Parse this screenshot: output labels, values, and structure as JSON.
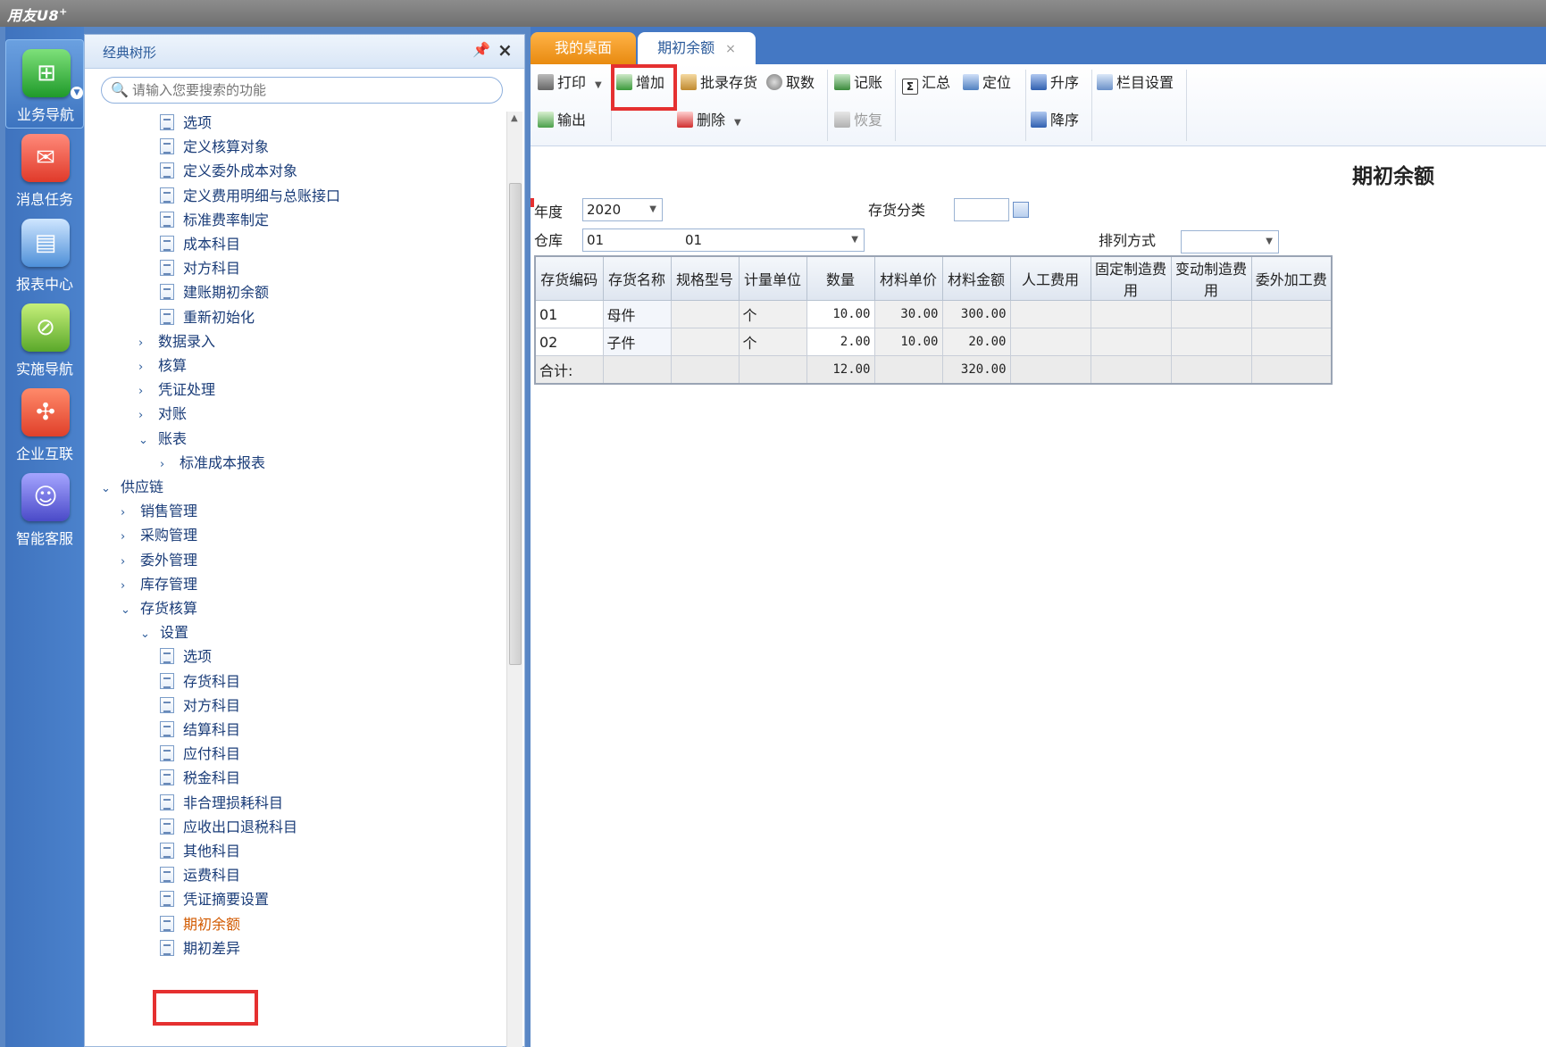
{
  "app": {
    "logo": "用友U8",
    "logo_sup": "+"
  },
  "leftnav": [
    {
      "label": "业务导航",
      "icon": "business-nav-icon",
      "glyph": "⊞"
    },
    {
      "label": "消息任务",
      "icon": "message-task-icon",
      "glyph": "✉"
    },
    {
      "label": "报表中心",
      "icon": "report-center-icon",
      "glyph": "▤"
    },
    {
      "label": "实施导航",
      "icon": "compass-icon",
      "glyph": "⊘"
    },
    {
      "label": "企业互联",
      "icon": "enterprise-link-icon",
      "glyph": "✣"
    },
    {
      "label": "智能客服",
      "icon": "customer-service-icon",
      "glyph": "☺"
    }
  ],
  "tree": {
    "title": "经典树形",
    "search_placeholder": "请输入您要搜索的功能",
    "items": [
      {
        "label": "选项",
        "type": "leaf"
      },
      {
        "label": "定义核算对象",
        "type": "leaf"
      },
      {
        "label": "定义委外成本对象",
        "type": "leaf"
      },
      {
        "label": "定义费用明细与总账接口",
        "type": "leaf"
      },
      {
        "label": "标准费率制定",
        "type": "leaf"
      },
      {
        "label": "成本科目",
        "type": "leaf"
      },
      {
        "label": "对方科目",
        "type": "leaf"
      },
      {
        "label": "建账期初余额",
        "type": "leaf"
      },
      {
        "label": "重新初始化",
        "type": "leaf"
      },
      {
        "label": "数据录入",
        "type": "collapsed"
      },
      {
        "label": "核算",
        "type": "collapsed"
      },
      {
        "label": "凭证处理",
        "type": "collapsed"
      },
      {
        "label": "对账",
        "type": "collapsed"
      },
      {
        "label": "账表",
        "type": "expanded"
      },
      {
        "label": "标准成本报表",
        "type": "collapsed"
      },
      {
        "label": "供应链",
        "type": "expanded"
      },
      {
        "label": "销售管理",
        "type": "collapsed"
      },
      {
        "label": "采购管理",
        "type": "collapsed"
      },
      {
        "label": "委外管理",
        "type": "collapsed"
      },
      {
        "label": "库存管理",
        "type": "collapsed"
      },
      {
        "label": "存货核算",
        "type": "expanded"
      },
      {
        "label": "设置",
        "type": "expanded"
      },
      {
        "label": "选项",
        "type": "leaf"
      },
      {
        "label": "存货科目",
        "type": "leaf"
      },
      {
        "label": "对方科目",
        "type": "leaf"
      },
      {
        "label": "结算科目",
        "type": "leaf"
      },
      {
        "label": "应付科目",
        "type": "leaf"
      },
      {
        "label": "税金科目",
        "type": "leaf"
      },
      {
        "label": "非合理损耗科目",
        "type": "leaf"
      },
      {
        "label": "应收出口退税科目",
        "type": "leaf"
      },
      {
        "label": "其他科目",
        "type": "leaf"
      },
      {
        "label": "运费科目",
        "type": "leaf"
      },
      {
        "label": "凭证摘要设置",
        "type": "leaf"
      },
      {
        "label": "期初余额",
        "type": "leaf",
        "selected": true
      },
      {
        "label": "期初差异",
        "type": "leaf"
      }
    ]
  },
  "tabs": {
    "desktop": "我的桌面",
    "current": "期初余额",
    "close": "×"
  },
  "toolbar": {
    "print": "打印",
    "add": "增加",
    "batch": "批录存货",
    "fetch": "取数",
    "post": "记账",
    "summary": "汇总",
    "locate": "定位",
    "asc": "升序",
    "columns": "栏目设置",
    "export": "输出",
    "delete": "删除",
    "restore": "恢复",
    "desc": "降序",
    "sum_glyph": "Σ"
  },
  "form": {
    "title": "期初余额",
    "year_label": "年度",
    "year_value": "2020",
    "category_label": "存货分类",
    "category_value": "",
    "warehouse_label": "仓库",
    "warehouse_code": "01",
    "warehouse_name": "01",
    "sort_label": "排列方式",
    "sort_value": ""
  },
  "grid": {
    "headers": [
      "存货编码",
      "存货名称",
      "规格型号",
      "计量单位",
      "数量",
      "材料单价",
      "材料金额",
      "人工费用",
      "固定制造费用",
      "变动制造费用",
      "委外加工费"
    ],
    "rows": [
      [
        "01",
        "母件",
        "",
        "个",
        "10.00",
        "30.00",
        "300.00",
        "",
        "",
        "",
        ""
      ],
      [
        "02",
        "子件",
        "",
        "个",
        "2.00",
        "10.00",
        "20.00",
        "",
        "",
        "",
        ""
      ]
    ],
    "total": [
      "合计:",
      "",
      "",
      "",
      "12.00",
      "",
      "320.00",
      "",
      "",
      "",
      ""
    ]
  }
}
